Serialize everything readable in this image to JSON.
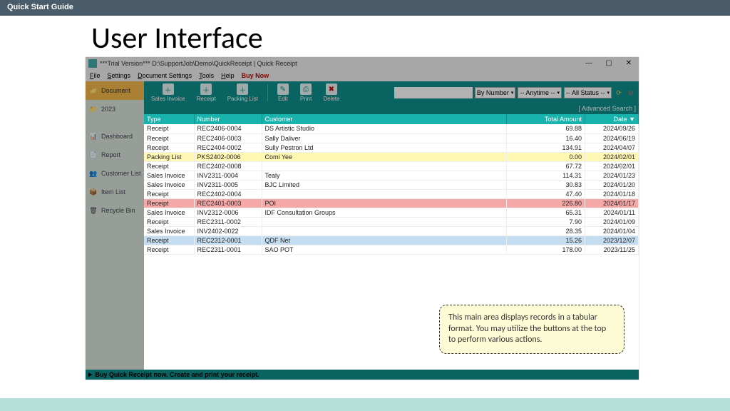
{
  "page": {
    "topbar": "Quick Start Guide",
    "title": "User Interface"
  },
  "win": {
    "title": "***Trial Version*** D:\\SupportJob\\Demo\\QuickReceipt | Quick Receipt",
    "menus": [
      "File",
      "Settings",
      "Document Settings",
      "Tools",
      "Help"
    ],
    "buy": "Buy Now"
  },
  "sidebar": {
    "items": [
      {
        "icon": "folder",
        "label": "Document",
        "sel": true
      },
      {
        "icon": "folder",
        "label": "2023"
      },
      {
        "icon": "dash",
        "label": "Dashboard"
      },
      {
        "icon": "report",
        "label": "Report"
      },
      {
        "icon": "user",
        "label": "Customer List"
      },
      {
        "icon": "box",
        "label": "Item List"
      },
      {
        "icon": "trash",
        "label": "Recycle Bin"
      }
    ]
  },
  "toolbar": {
    "buttons": [
      {
        "name": "sales-invoice-button",
        "label": "Sales Invoice",
        "icon": "＋"
      },
      {
        "name": "receipt-button",
        "label": "Receipt",
        "icon": "＋"
      },
      {
        "name": "packing-list-button",
        "label": "Packing List",
        "icon": "＋"
      },
      {
        "name": "edit-button",
        "label": "Edit",
        "icon": "✎",
        "sep_before": true
      },
      {
        "name": "print-button",
        "label": "Print",
        "icon": "⎙"
      },
      {
        "name": "delete-button",
        "label": "Delete",
        "icon": "✖",
        "cls": "tb-del"
      }
    ],
    "search_placeholder": "",
    "dd1": "By Number",
    "dd2": "-- Anytime --",
    "dd3": "-- All Status --",
    "advanced": "[ Advanced Search ]"
  },
  "table": {
    "cols": [
      "Type",
      "Number",
      "Customer",
      "Total Amount",
      "Date ▼"
    ],
    "rows": [
      {
        "type": "Receipt",
        "num": "REC2406-0004",
        "cust": "DS Artistic Studio",
        "amt": "69.88",
        "date": "2024/09/26"
      },
      {
        "type": "Receipt",
        "num": "REC2406-0003",
        "cust": "Sally Daliver",
        "amt": "16.40",
        "date": "2024/06/19"
      },
      {
        "type": "Receipt",
        "num": "REC2404-0002",
        "cust": "Sully Pestron Ltd",
        "amt": "134.91",
        "date": "2024/04/07"
      },
      {
        "type": "Packing List",
        "num": "PKS2402-0006",
        "cust": "Comi Yee",
        "amt": "0.00",
        "date": "2024/02/01",
        "hl": "yellow"
      },
      {
        "type": "Receipt",
        "num": "REC2402-0008",
        "cust": "",
        "amt": "67.72",
        "date": "2024/02/01"
      },
      {
        "type": "Sales Invoice",
        "num": "INV2311-0004",
        "cust": "Tealy",
        "amt": "114.31",
        "date": "2024/01/23"
      },
      {
        "type": "Sales Invoice",
        "num": "INV2311-0005",
        "cust": "BJC Limited",
        "amt": "30.83",
        "date": "2024/01/20"
      },
      {
        "type": "Receipt",
        "num": "REC2402-0004",
        "cust": "",
        "amt": "47.40",
        "date": "2024/01/18"
      },
      {
        "type": "Receipt",
        "num": "REC2401-0003",
        "cust": "POI",
        "amt": "226.80",
        "date": "2024/01/17",
        "hl": "red"
      },
      {
        "type": "Sales Invoice",
        "num": "INV2312-0006",
        "cust": "IDF Consultation Groups",
        "amt": "65.31",
        "date": "2024/01/11"
      },
      {
        "type": "Receipt",
        "num": "REC2311-0002",
        "cust": "",
        "amt": "7.90",
        "date": "2024/01/09"
      },
      {
        "type": "Sales Invoice",
        "num": "INV2402-0022",
        "cust": "",
        "amt": "28.35",
        "date": "2024/01/04"
      },
      {
        "type": "Receipt",
        "num": "REC2312-0001",
        "cust": "QDF Net",
        "amt": "15.26",
        "date": "2023/12/07",
        "hl": "blue"
      },
      {
        "type": "Receipt",
        "num": "REC2311-0001",
        "cust": "SAO POT",
        "amt": "178.00",
        "date": "2023/11/25"
      }
    ]
  },
  "status": "Buy Quick Receipt now. Create and print your receipt.",
  "callout": "This main area displays records in a tabular format. You may utilize the buttons at the top to perform various actions."
}
